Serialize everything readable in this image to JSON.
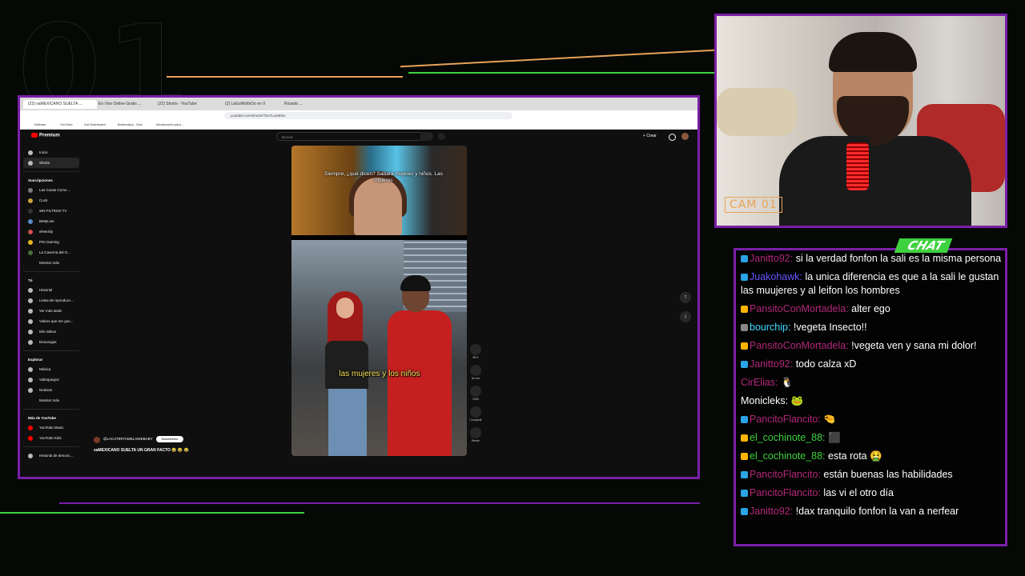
{
  "overlay": {
    "background_number": "01",
    "accent_color": "#7a1fa8",
    "line_orange": "#e8a357",
    "line_green": "#3fd23f"
  },
  "browser": {
    "tabs": [
      "(22) xaMEXICANO SUELTA ...",
      "En Vivo Online Gratis ...",
      "(22) Shorts - YouTube",
      "(2) LaGoWolfsOo en X",
      "Ricardo ..."
    ],
    "url": "youtube.com/shorts/Ybo7Lue9Kbc",
    "bookmarks": [
      "Noticias",
      "YouTube",
      "Dot Dashboard",
      "BrokenApp - Kick",
      "Introducción para ..."
    ]
  },
  "youtube": {
    "logo": "Premium",
    "search_placeholder": "Buscar",
    "create_label": "Crear",
    "sidebar": {
      "main": [
        {
          "label": "Inicio",
          "icon": "home-icon"
        },
        {
          "label": "Shorts",
          "icon": "shorts-icon",
          "active": true
        }
      ],
      "subs_header": "Suscripciones",
      "subs": [
        "Las Cosas Como ...",
        "Cuck",
        "SIN FILTROS TV",
        "BettyLive",
        "elHeckly",
        "PGI Gaming",
        "La Caverna del G...",
        "Mostrar más"
      ],
      "you_header": "Tú",
      "you": [
        "Historial",
        "Listas de reproducc...",
        "Ver más tarde",
        "Videos que me gus...",
        "Mis videos",
        "Descargas"
      ],
      "explore_header": "Explorar",
      "explore": [
        "Música",
        "Videojuegos",
        "Noticias",
        "Mostrar más"
      ],
      "more_header": "Más de YouTube",
      "more": [
        "YouTube Music",
        "YouTube Kids"
      ],
      "footer": "Historial de denunc..."
    },
    "short": {
      "top_caption": "Siempre, ¿qué dicen? Sabara mujeres y niños. Las mujeres",
      "bottom_caption": "las mujeres y los niños",
      "channel": "@LACATIRITAMELANIEBABY",
      "subscribe": "Suscribirme",
      "title": "xaMEXICANO SUELTA UN GRAN FACTO 😂 😂 😂",
      "actions": [
        "98 K",
        "No me",
        "2000",
        "Compartir",
        "Remix"
      ]
    }
  },
  "cam": {
    "label": "CAM 01"
  },
  "chat": {
    "tag": "CHAT",
    "messages": [
      {
        "user": "Janitto92",
        "color": "#b3287a",
        "icon": "#2aa3e8",
        "text": "si la verdad fonfon la sali es la misma persona"
      },
      {
        "user": "Juakohawk",
        "color": "#6a55ff",
        "icon": "#2aa3e8",
        "text": "la unica diferencia es que a la sali le gustan las muujeres y al leifon los hombres"
      },
      {
        "user": "PansitoConMortadela",
        "color": "#b3287a",
        "icon": "#ffb400",
        "text": "alter ego"
      },
      {
        "user": "bourchip",
        "color": "#3fd8ff",
        "icon": "#888888",
        "text": "!vegeta Insecto!!"
      },
      {
        "user": "PansitoConMortadela",
        "color": "#b3287a",
        "icon": "#ffb400",
        "text": "!vegeta ven y sana mi dolor!"
      },
      {
        "user": "Janitto92",
        "color": "#b3287a",
        "icon": "#2aa3e8",
        "text": "todo calza xD"
      },
      {
        "user": "CirElias",
        "color": "#b3287a",
        "icon": "",
        "text": "🐧"
      },
      {
        "user": "Monicleks",
        "color": "#ffffff",
        "icon": "",
        "text": "🐸"
      },
      {
        "user": "PancitoFlancito",
        "color": "#b3287a",
        "icon": "#2aa3e8",
        "text": "🤏"
      },
      {
        "user": "el_cochinote_88",
        "color": "#3fd23f",
        "icon": "#ffb400",
        "text": "⬛"
      },
      {
        "user": "el_cochinote_88",
        "color": "#3fd23f",
        "icon": "#ffb400",
        "text": "esta rota 🤮"
      },
      {
        "user": "PancitoFlancito",
        "color": "#b3287a",
        "icon": "#2aa3e8",
        "text": "están buenas las habilidades"
      },
      {
        "user": "PancitoFlancito",
        "color": "#b3287a",
        "icon": "#2aa3e8",
        "text": "las vi el otro día"
      },
      {
        "user": "Janitto92",
        "color": "#b3287a",
        "icon": "#2aa3e8",
        "text": "!dax tranquilo fonfon la van a nerfear"
      }
    ]
  }
}
